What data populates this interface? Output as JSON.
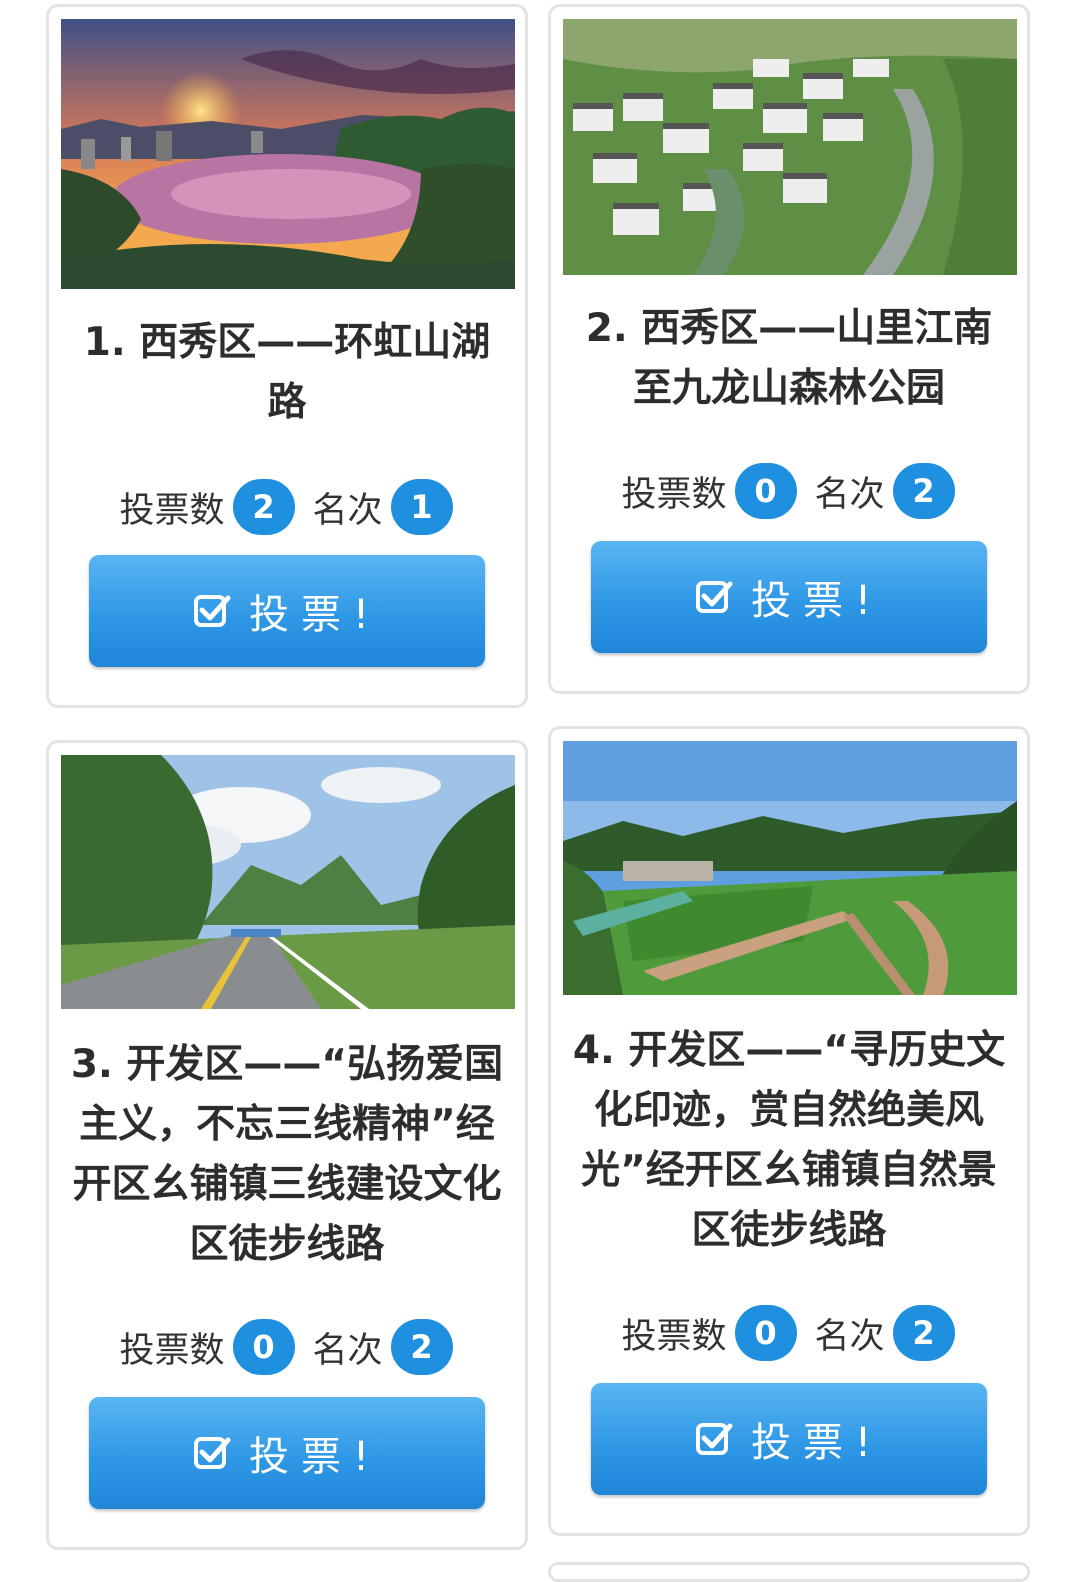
{
  "items": [
    {
      "title": "1. 西秀区——环虹山湖路",
      "votes_label": "投票数",
      "votes": "2",
      "rank_label": "名次",
      "rank": "1",
      "button": "投票!"
    },
    {
      "title": "2. 西秀区——山里江南至九龙山森林公园",
      "votes_label": "投票数",
      "votes": "0",
      "rank_label": "名次",
      "rank": "2",
      "button": "投票!"
    },
    {
      "title": "3. 开发区——“弘扬爱国主义，不忘三线精神”经开区幺铺镇三线建设文化区徒步线路",
      "votes_label": "投票数",
      "votes": "0",
      "rank_label": "名次",
      "rank": "2",
      "button": "投票!"
    },
    {
      "title": "4. 开发区——“寻历史文化印迹，赏自然绝美风光”经开区幺铺镇自然景区徒步线路",
      "votes_label": "投票数",
      "votes": "0",
      "rank_label": "名次",
      "rank": "2",
      "button": "投票!"
    }
  ],
  "colors": {
    "accent": "#1f8fe0",
    "button_top": "#5ab5f2",
    "button_bottom": "#1f86d8",
    "card_border": "#e3e3e3"
  },
  "icons": {
    "vote": "check-square-icon"
  }
}
